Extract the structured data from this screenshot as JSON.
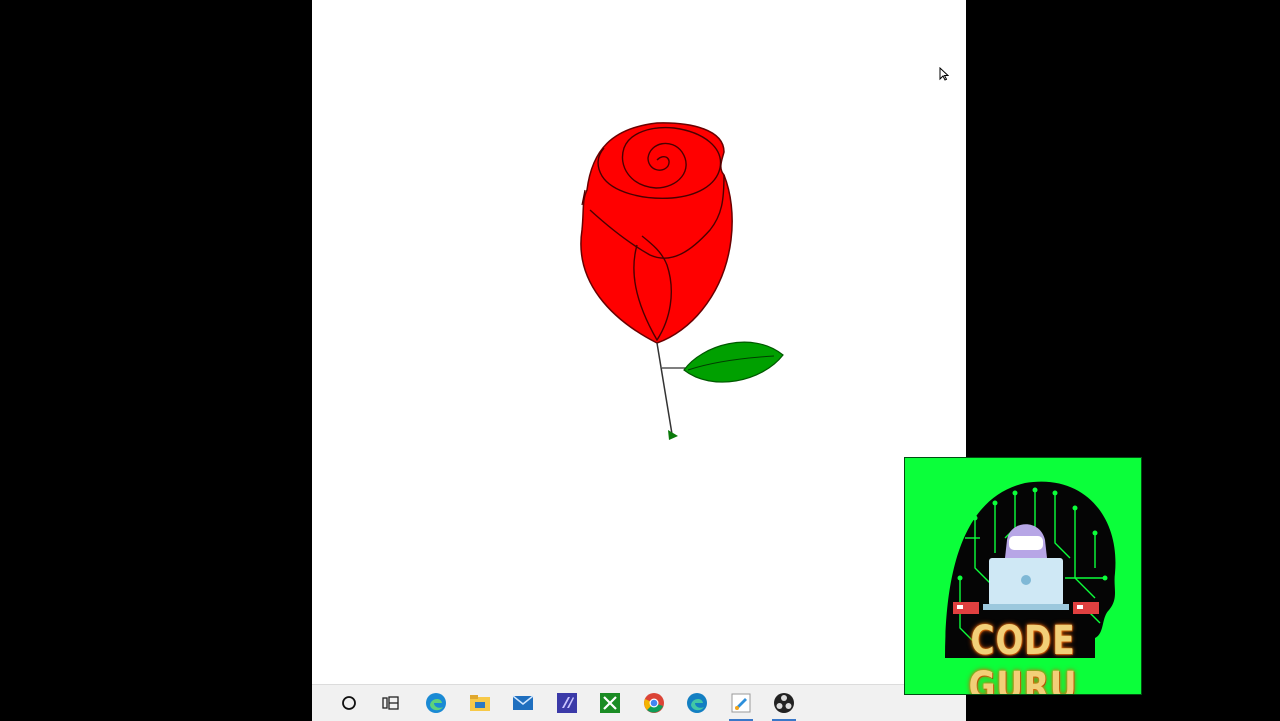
{
  "screen": {
    "background": "#000000",
    "canvas_background": "#ffffff"
  },
  "drawing": {
    "subject": "rose",
    "colors": {
      "petal": "#ff0000",
      "leaf": "#00a000",
      "outline": "#000000",
      "stem": "#000000"
    }
  },
  "cursor": {
    "icon": "mouse-pointer-icon"
  },
  "taskbar": {
    "icons": [
      {
        "name": "cortana-search-icon"
      },
      {
        "name": "task-view-icon"
      },
      {
        "name": "edge-icon"
      },
      {
        "name": "file-explorer-icon"
      },
      {
        "name": "mail-icon"
      },
      {
        "name": "photo-app-icon"
      },
      {
        "name": "xbox-icon"
      },
      {
        "name": "chrome-icon"
      },
      {
        "name": "edge-beta-icon"
      },
      {
        "name": "paint-app-icon",
        "active": true
      },
      {
        "name": "obs-icon",
        "active": true
      }
    ]
  },
  "logo": {
    "title": "CODE GURU",
    "background": "#0bff3a",
    "text_color": "#f2cf78"
  }
}
